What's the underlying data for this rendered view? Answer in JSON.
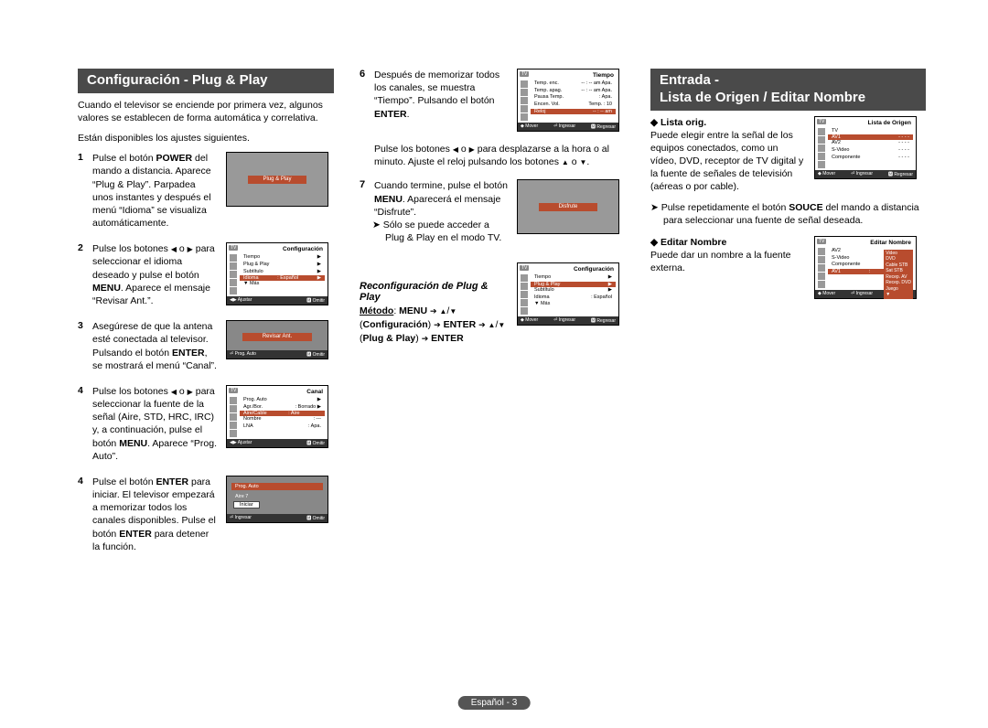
{
  "page_footer": "Español - 3",
  "leftSection": {
    "title": "Configuración - Plug & Play",
    "intro1": "Cuando el televisor se enciende por primera vez, algunos valores se establecen de forma automática y correlativa.",
    "intro2": "Están disponibles los ajustes siguientes.",
    "steps": [
      {
        "num": "1",
        "text": "Pulse el botón <b>POWER</b> del mando a distancia. Aparece “Plug & Play”. Parpadea unos instantes y después el menú “Idioma” se visualiza automáticamente.",
        "osd": {
          "type": "plain",
          "hl": "Plug & Play"
        }
      },
      {
        "num": "2",
        "text": "Pulse los botones <span class='tri'></span> o <span class='tri-r'></span> para seleccionar el idioma deseado y pulse el botón <b>MENU</b>. Aparece el mensaje “Revisar Ant.”.",
        "osd": {
          "type": "menu",
          "badge": "TV",
          "title": "Configuración",
          "rows": [
            {
              "l": "Tiempo",
              "r": "▶"
            },
            {
              "l": "Plug & Play",
              "r": "▶"
            },
            {
              "l": "Subtítulo",
              "r": "▶"
            }
          ],
          "sel": {
            "l": "Idioma",
            "c": ": Español",
            "r": "▶"
          },
          "more": "▼ Más",
          "ft": [
            "◀▶ Ajustar",
            "🅼 Omitir"
          ]
        }
      },
      {
        "num": "3",
        "text": "Asegúrese de que la antena esté conectada al televisor. Pulsando el botón <b>ENTER</b>, se mostrará el menú “Canal”.",
        "osd": {
          "type": "msg",
          "hl": "Revisar Ant.",
          "ft": [
            "⏎ Prog. Auto",
            "🅼 Omitir"
          ]
        }
      },
      {
        "num": "4",
        "text": "Pulse los botones <span class='tri'></span> o <span class='tri-r'></span> para seleccionar la fuente de la señal (Aire, STD, HRC, IRC) y, a continuación, pulse el botón <b>MENU</b>. Aparece “Prog. Auto”.",
        "osd": {
          "type": "menu",
          "badge": "TV",
          "title": "Canal",
          "rows": [
            {
              "l": "Prog. Auto",
              "r": "▶"
            },
            {
              "l": "Agr./Bor.",
              "r": ": Borrado ▶"
            }
          ],
          "sel": {
            "l": "Aire/Cable",
            "c": ": Aire",
            "r": ""
          },
          "rows2": [
            {
              "l": "Nombre",
              "r": ": ---"
            },
            {
              "l": "LNA",
              "r": ": Apa."
            }
          ],
          "ft": [
            "◀▶ Ajustar",
            "🅼 Omitir"
          ]
        }
      },
      {
        "num": "4",
        "text": "Pulse el botón <b>ENTER</b> para iniciar. El televisor empezará a memorizar todos los canales disponibles. Pulse el botón <b>ENTER</b> para detener la función.",
        "osd": {
          "type": "prog",
          "hl": "Prog. Auto",
          "line2": "Aire   7",
          "btn": "Iniciar",
          "ft": [
            "⏎ Ingresar",
            "🅼 Omitir"
          ]
        }
      }
    ]
  },
  "midSection": {
    "step6_a": "Después de memorizar todos los canales, se muestra “Tiempo”. Pulsando el botón <b>ENTER</b>.",
    "step6_cont": "Pulse los botones <span class='tri'></span> o <span class='tri-r'></span> para desplazarse a la hora o al minuto. Ajuste el reloj pulsando los botones <span class='tri-u'></span> o <span class='tri-d'></span>.",
    "osd6": {
      "badge": "TV",
      "title": "Tiempo",
      "sel": {
        "l": "Reloj",
        "r": "-- : -- am"
      },
      "rows": [
        {
          "l": "Temp. enc.",
          "r": "-- : -- am Apa."
        },
        {
          "l": "Temp. apag.",
          "r": "-- : -- am Apa."
        },
        {
          "l": "Pausa Temp.",
          "r": ": Apa."
        },
        {
          "l": "Encen. Vol.",
          "r": "Temp. : 10"
        }
      ],
      "ft": [
        "◆ Mover",
        "⏎ Ingresar",
        "🅼 Regresar"
      ]
    },
    "step7": "Cuando termine, pulse el botón <b>MENU</b>. Aparecerá el mensaje “Disfrute”.",
    "step7_note": "Sólo se puede acceder a Plug & Play en el modo TV.",
    "osd7": {
      "type": "plain",
      "hl": "Disfrute"
    },
    "reconfig_head": "Reconfiguración de Plug & Play",
    "method": "<u><b>Método</b></u>: <b>MENU</b> <span class='arrow-r'></span> <span class='tri-u'></span>/<span class='tri-d'></span> (<b>Configuración</b>) <span class='arrow-r'></span> <b>ENTER</b> <span class='arrow-r'></span> <span class='tri-u'></span>/<span class='tri-d'></span> (<b>Plug & Play</b>) <span class='arrow-r'></span> <b>ENTER</b>",
    "osdR": {
      "badge": "TV",
      "title": "Configuración",
      "rows": [
        {
          "l": "Tiempo",
          "r": "▶"
        }
      ],
      "sel": {
        "l": "Plug & Play",
        "r": "▶"
      },
      "rows2": [
        {
          "l": "Subtítulo",
          "r": "▶"
        },
        {
          "l": "Idioma",
          "r": ": Español"
        },
        {
          "l": "▼ Más",
          "r": ""
        }
      ],
      "ft": [
        "◆ Mover",
        "⏎ Ingresar",
        "🅼 Regresar"
      ]
    }
  },
  "rightSection": {
    "title": "Entrada -\nLista de Origen / Editar Nombre",
    "lista_head": "Lista orig.",
    "lista_text": "Puede elegir entre la señal de los equipos conectados, como un vídeo, DVD, receptor de TV digital y la fuente de señales de televisión (aéreas o por cable).",
    "osdL": {
      "badge": "TV",
      "title": "Lista de Origen",
      "rows": [
        {
          "l": "TV",
          "r": ""
        }
      ],
      "sel": {
        "l": "AV1",
        "r": "- - - -"
      },
      "rows2": [
        {
          "l": "AV2",
          "r": "- - - -"
        },
        {
          "l": "S-Video",
          "r": "- - - -"
        },
        {
          "l": "Componente",
          "r": "- - - -"
        }
      ],
      "ft": [
        "◆ Mover",
        "⏎ Ingresar",
        "🅼 Regresar"
      ]
    },
    "lista_note": "Pulse repetidamente el botón <b>SOUCE</b> del mando a distancia para seleccionar una fuente de señal deseada.",
    "editar_head": "Editar Nombre",
    "editar_text": "Puede dar un nombre a la fuente externa.",
    "osdE": {
      "badge": "TV",
      "title": "Editar Nombre",
      "sel": {
        "l": "AV1",
        "c": ":",
        "r": "- - - -"
      },
      "rows": [
        {
          "l": "AV2",
          "r": ""
        },
        {
          "l": "S-Video",
          "r": ""
        },
        {
          "l": "Componente",
          "r": ""
        }
      ],
      "popup": [
        "Video",
        "DVD",
        "Cable STB",
        "Sat STB",
        "Recep. AV",
        "Recep. DVD",
        "Juego",
        "▼"
      ],
      "ft": [
        "◆ Mover",
        "⏎ Ingresar",
        "🅼 Regresar"
      ]
    }
  }
}
